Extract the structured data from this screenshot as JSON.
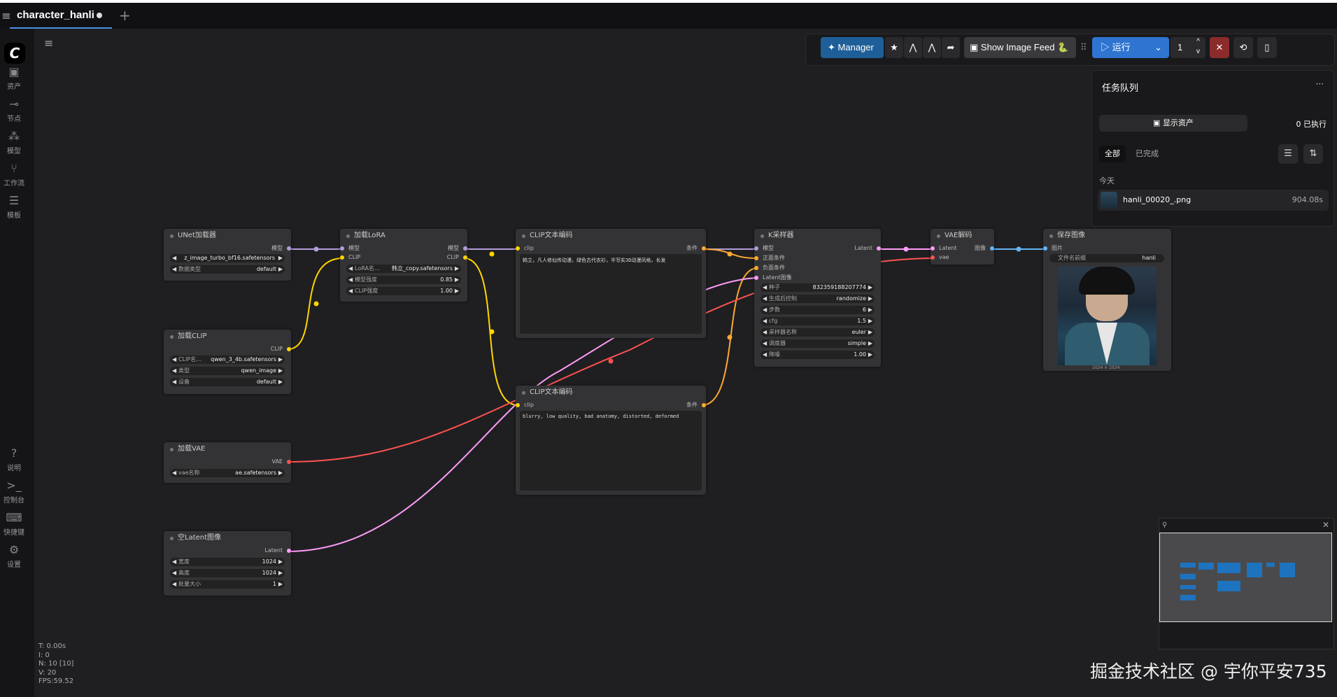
{
  "tab": {
    "title": "character_hanli"
  },
  "sidebar": {
    "items": [
      {
        "icon": "image-icon",
        "label": "资产"
      },
      {
        "icon": "node-icon",
        "label": "节点"
      },
      {
        "icon": "model-icon",
        "label": "模型"
      },
      {
        "icon": "workflow-icon",
        "label": "工作流"
      },
      {
        "icon": "template-icon",
        "label": "模板"
      }
    ],
    "bottom": [
      {
        "icon": "help-icon",
        "label": "说明"
      },
      {
        "icon": "terminal-icon",
        "label": "控制台"
      },
      {
        "icon": "keyboard-icon",
        "label": "快捷键"
      },
      {
        "icon": "gear-icon",
        "label": "设置"
      }
    ]
  },
  "toolbar": {
    "manager": "Manager",
    "image_feed": "Show Image Feed 🐍",
    "run": "运行",
    "batch": "1"
  },
  "queue": {
    "title": "任务队列",
    "more": "···",
    "show_assets": "显示资产",
    "executing": "0 已执行",
    "tab_all": "全部",
    "tab_done": "已完成",
    "today": "今天",
    "item_name": "hanli_00020_.png",
    "item_time": "904.08s"
  },
  "nodes": {
    "unet": {
      "title": "UNet加载器",
      "out": "模型",
      "w1_label": "",
      "w1_value": "z_image_turbo_bf16.safetensors",
      "w2_label": "数据类型",
      "w2_value": "default"
    },
    "lora": {
      "title": "加载LoRA",
      "in1": "模型",
      "in2": "CLIP",
      "out1": "模型",
      "out2": "CLIP",
      "w1_label": "LoRA名…",
      "w1_value": "韩立_copy.safetensors",
      "w2_label": "模型强度",
      "w2_value": "0.85",
      "w3_label": "CLIP强度",
      "w3_value": "1.00"
    },
    "clip_loader": {
      "title": "加载CLIP",
      "out": "CLIP",
      "w1_label": "CLIP名…",
      "w1_value": "qwen_3_4b.safetensors",
      "w2_label": "类型",
      "w2_value": "qwen_image",
      "w3_label": "设备",
      "w3_value": "default"
    },
    "vae_loader": {
      "title": "加载VAE",
      "out": "VAE",
      "w1_label": "vae名称",
      "w1_value": "ae.safetensors"
    },
    "latent": {
      "title": "空Latent图像",
      "out": "Latent",
      "w1_label": "宽度",
      "w1_value": "1024",
      "w2_label": "高度",
      "w2_value": "1024",
      "w3_label": "批量大小",
      "w3_value": "1"
    },
    "clip_pos": {
      "title": "CLIP文本编码",
      "in": "clip",
      "out": "条件",
      "text": "韩立，凡人修仙传动漫，绿色古代衣衫，半写实3D动漫风格，长发"
    },
    "clip_neg": {
      "title": "CLIP文本编码",
      "in": "clip",
      "out": "条件",
      "text": "blurry, low quality, bad anatomy, distorted, deformed"
    },
    "ksampler": {
      "title": "K采样器",
      "in1": "模型",
      "in2": "正面条件",
      "in3": "负面条件",
      "in4": "Latent图像",
      "out": "Latent",
      "widgets": [
        {
          "label": "种子",
          "value": "832359188207774"
        },
        {
          "label": "生成后控制",
          "value": "randomize"
        },
        {
          "label": "步数",
          "value": "6"
        },
        {
          "label": "cfg",
          "value": "1.5"
        },
        {
          "label": "采样器名称",
          "value": "euler"
        },
        {
          "label": "调度器",
          "value": "simple"
        },
        {
          "label": "降噪",
          "value": "1.00"
        }
      ]
    },
    "vae_decode": {
      "title": "VAE解码",
      "in1": "Latent",
      "in2": "vae",
      "out": "图像"
    },
    "save": {
      "title": "保存图像",
      "in": "图片",
      "w1_label": "文件名前缀",
      "w1_value": "hanli",
      "caption": "1024 × 1024"
    }
  },
  "stats": {
    "t": "T: 0.00s",
    "i": "I: 0",
    "n": "N: 10 [10]",
    "v": "V: 20",
    "fps": "FPS:59.52"
  },
  "watermark": "掘金技术社区 @ 宇你平安735",
  "colors": {
    "model": "#b39ddb",
    "clip": "#ffd500",
    "vae": "#ff6e6e",
    "latent": "#ff9cf9",
    "conditioning": "#ffa931",
    "image": "#64b5f6",
    "accent": "#1e73be"
  }
}
